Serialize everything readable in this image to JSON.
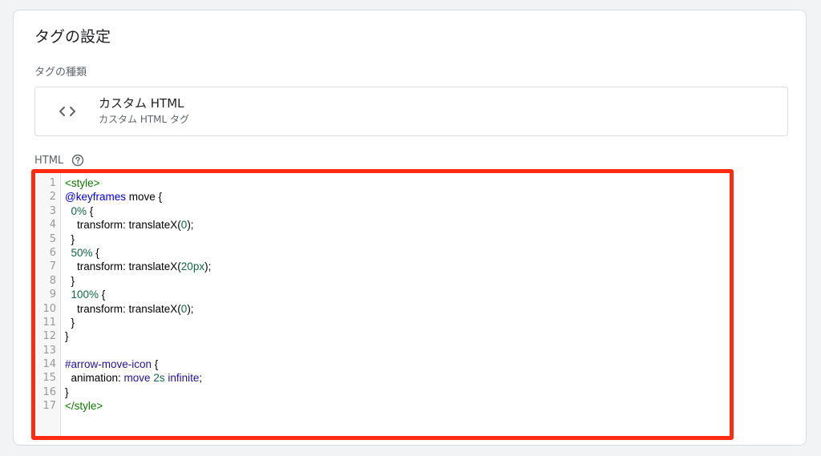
{
  "card": {
    "title": "タグの設定"
  },
  "tag_type": {
    "section_label": "タグの種類",
    "name": "カスタム HTML",
    "subtitle": "カスタム HTML タグ",
    "icon": "code-brackets-icon"
  },
  "html_field": {
    "label": "HTML",
    "help_icon": "help-circle-icon"
  },
  "editor": {
    "highlight_color": "#ff2a12",
    "line_numbers": [
      "1",
      "2",
      "3",
      "4",
      "5",
      "6",
      "7",
      "8",
      "9",
      "10",
      "11",
      "12",
      "13",
      "14",
      "15",
      "16",
      "17"
    ],
    "lines": [
      [
        {
          "t": "tag",
          "v": "<style>"
        }
      ],
      [
        {
          "t": "def",
          "v": "@keyframes"
        },
        {
          "t": "plain",
          "v": " move {"
        }
      ],
      [
        {
          "t": "plain",
          "v": "  "
        },
        {
          "t": "num",
          "v": "0%"
        },
        {
          "t": "plain",
          "v": " {"
        }
      ],
      [
        {
          "t": "plain",
          "v": "    transform: translateX("
        },
        {
          "t": "num",
          "v": "0"
        },
        {
          "t": "plain",
          "v": ");"
        }
      ],
      [
        {
          "t": "plain",
          "v": "  }"
        }
      ],
      [
        {
          "t": "plain",
          "v": "  "
        },
        {
          "t": "num",
          "v": "50%"
        },
        {
          "t": "plain",
          "v": " {"
        }
      ],
      [
        {
          "t": "plain",
          "v": "    transform: translateX("
        },
        {
          "t": "num",
          "v": "20px"
        },
        {
          "t": "plain",
          "v": ");"
        }
      ],
      [
        {
          "t": "plain",
          "v": "  }"
        }
      ],
      [
        {
          "t": "plain",
          "v": "  "
        },
        {
          "t": "num",
          "v": "100%"
        },
        {
          "t": "plain",
          "v": " {"
        }
      ],
      [
        {
          "t": "plain",
          "v": "    transform: translateX("
        },
        {
          "t": "num",
          "v": "0"
        },
        {
          "t": "plain",
          "v": ");"
        }
      ],
      [
        {
          "t": "plain",
          "v": "  }"
        }
      ],
      [
        {
          "t": "plain",
          "v": "}"
        }
      ],
      [
        {
          "t": "plain",
          "v": ""
        }
      ],
      [
        {
          "t": "atom",
          "v": "#arrow-move-icon"
        },
        {
          "t": "plain",
          "v": " {"
        }
      ],
      [
        {
          "t": "plain",
          "v": "  animation: "
        },
        {
          "t": "atom",
          "v": "move"
        },
        {
          "t": "plain",
          "v": " "
        },
        {
          "t": "num",
          "v": "2s"
        },
        {
          "t": "plain",
          "v": " "
        },
        {
          "t": "atom",
          "v": "infinite"
        },
        {
          "t": "plain",
          "v": ";"
        }
      ],
      [
        {
          "t": "plain",
          "v": "}"
        }
      ],
      [
        {
          "t": "tag",
          "v": "</style>"
        }
      ]
    ]
  }
}
